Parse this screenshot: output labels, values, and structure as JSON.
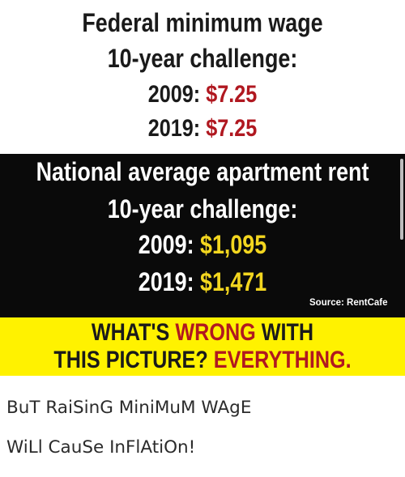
{
  "meme": {
    "white_panel": {
      "line1": "Federal minimum wage",
      "line2": "10-year challenge:",
      "row2009_label": "2009:",
      "row2009_value": "$7.25",
      "row2019_label": "2019:",
      "row2019_value": "$7.25"
    },
    "black_panel": {
      "line1": "National average apartment rent",
      "line2": "10-year challenge:",
      "row2009_label": "2009:",
      "row2009_value": "$1,095",
      "row2019_label": "2019:",
      "row2019_value": "$1,471",
      "source": "Source: RentCafe"
    },
    "yellow_panel": {
      "line1_a": "WHAT'S ",
      "line1_b": "WRONG",
      "line1_c": " WITH",
      "line2_a": "THIS PICTURE? ",
      "line2_b": "EVERYTHING."
    }
  },
  "caption": {
    "line1": "BuT RaiSinG MiniMuM WAgE",
    "line2": "WiLl CauSe InFlAtiOn!"
  },
  "colors": {
    "red_accent": "#b01820",
    "gold_accent": "#f3d61f",
    "yellow_bg": "#fff200",
    "black_bg": "#0a0a0a"
  }
}
